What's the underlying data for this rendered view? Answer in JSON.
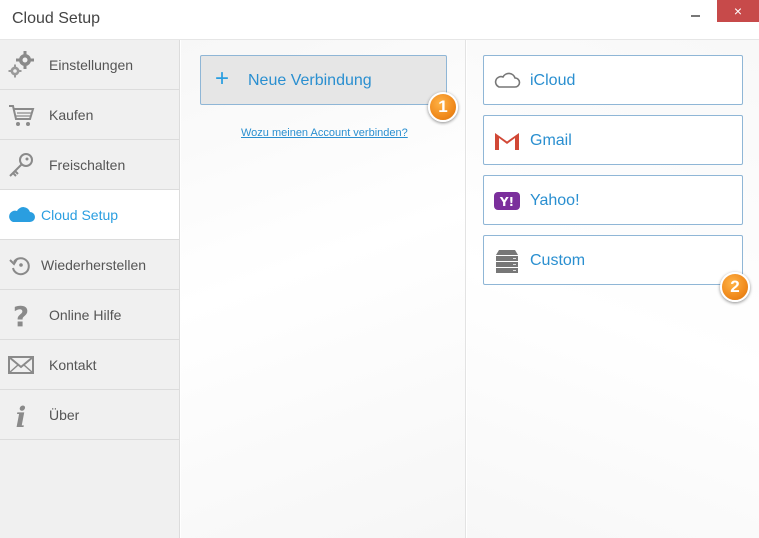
{
  "window": {
    "title": "Cloud Setup",
    "close_glyph": "×"
  },
  "sidebar": {
    "items": [
      {
        "label": "Einstellungen",
        "icon": "gears-icon"
      },
      {
        "label": "Kaufen",
        "icon": "cart-icon"
      },
      {
        "label": "Freischalten",
        "icon": "key-icon"
      },
      {
        "label": "Cloud Setup",
        "icon": "cloud-icon",
        "active": true
      },
      {
        "label": "Wiederherstellen",
        "icon": "restore-icon"
      },
      {
        "label": "Online Hilfe",
        "icon": "question-icon"
      },
      {
        "label": "Kontakt",
        "icon": "envelope-icon"
      },
      {
        "label": "Über",
        "icon": "info-icon"
      }
    ]
  },
  "main": {
    "new_connection_label": "Neue Verbindung",
    "plus_glyph": "+",
    "why_link": "Wozu meinen Account verbinden?",
    "badge_1": "1",
    "badge_2": "2"
  },
  "providers": [
    {
      "label": "iCloud",
      "icon": "icloud-icon"
    },
    {
      "label": "Gmail",
      "icon": "gmail-icon"
    },
    {
      "label": "Yahoo!",
      "icon": "yahoo-icon",
      "icon_text": "Y!"
    },
    {
      "label": "Custom",
      "icon": "server-icon"
    }
  ],
  "colors": {
    "accent": "#2a9ee0",
    "badge": "#f08a1c",
    "close": "#c74a4a"
  }
}
